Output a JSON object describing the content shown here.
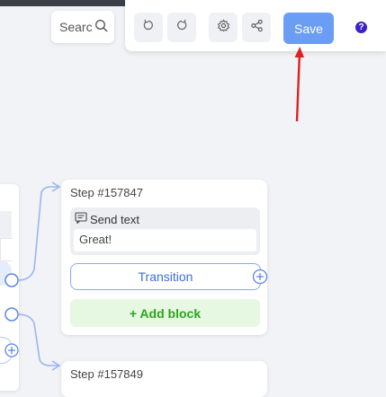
{
  "search": {
    "placeholder": "Searc"
  },
  "toolbar": {
    "save_label": "Save",
    "help_label": "?",
    "brand_color": "#6b9df5"
  },
  "steps": [
    {
      "title": "Step #157847",
      "block": {
        "label": "Send text",
        "value": "Great!"
      },
      "transition_label": "Transition",
      "add_block_label": "+ Add block"
    },
    {
      "title": "Step #157849"
    }
  ],
  "icons": [
    "search-icon",
    "undo-icon",
    "redo-icon",
    "settings-icon",
    "share-icon",
    "help-icon",
    "message-icon",
    "add-transition-icon"
  ]
}
